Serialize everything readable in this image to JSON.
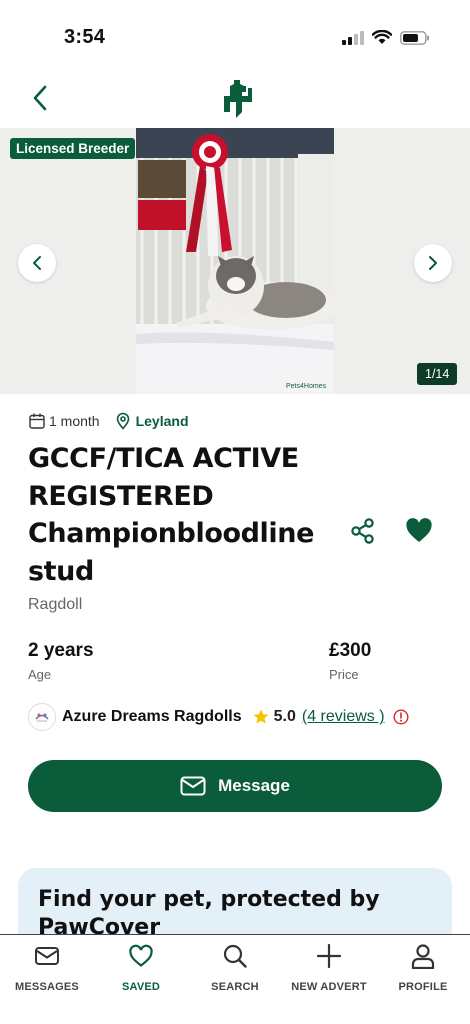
{
  "status_bar": {
    "time": "3:54"
  },
  "gallery": {
    "badge": "Licensed Breeder",
    "counter": "1/14",
    "watermark": "Pets4Homes"
  },
  "listing": {
    "posted": "1 month",
    "location": "Leyland",
    "title_lines": [
      "GCCF/TICA ACTIVE",
      "REGISTERED",
      "Championbloodline",
      "stud"
    ],
    "breed": "Ragdoll",
    "age_value": "2 years",
    "age_label": "Age",
    "price_value": "£300",
    "price_label": "Price"
  },
  "seller": {
    "name": "Azure Dreams Ragdolls",
    "rating": "5.0",
    "reviews": "(4 reviews )"
  },
  "actions": {
    "message": "Message"
  },
  "promo": {
    "text": "Find your pet, protected by PawCover"
  },
  "bottom_nav": [
    {
      "label": "MESSAGES",
      "icon": "envelope-icon"
    },
    {
      "label": "SAVED",
      "icon": "heart-outline-icon"
    },
    {
      "label": "SEARCH",
      "icon": "search-icon"
    },
    {
      "label": "NEW ADVERT",
      "icon": "plus-icon"
    },
    {
      "label": "PROFILE",
      "icon": "person-icon"
    }
  ],
  "colors": {
    "brand_green": "#0a5c3a",
    "star": "#f5c400",
    "info": "#d32f2f",
    "promo_bg": "#e3f0f8"
  }
}
